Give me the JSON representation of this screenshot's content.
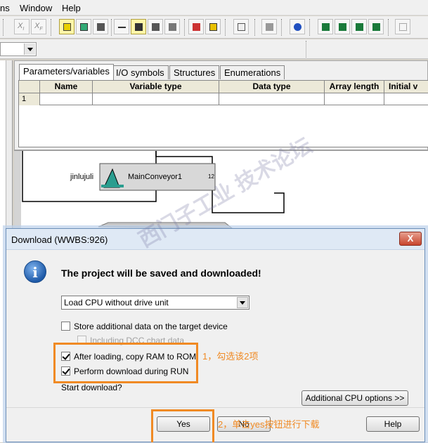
{
  "menu": [
    "ns",
    "Window",
    "Help"
  ],
  "toolbar": {
    "icons": [
      "xi-icon",
      "xf-icon",
      "block-icon",
      "download-icon",
      "compare-icon",
      "connect-icon",
      "insert-block-icon",
      "move-icon",
      "chart-icon",
      "parameters-icon",
      "upload-icon",
      "list-icon",
      "lock-icon",
      "test-mode-icon",
      "monitor-icon",
      "trend1-icon",
      "trend2-icon",
      "trend3-icon",
      "trend4-icon",
      "settings-grid-icon"
    ]
  },
  "interface_editor": {
    "tabs": [
      "Parameters/variables",
      "I/O symbols",
      "Structures",
      "Enumerations"
    ],
    "columns": [
      "Name",
      "Variable type",
      "Data type",
      "Array length",
      "Initial v"
    ],
    "rows": [
      {
        "num": "1"
      }
    ]
  },
  "chart": {
    "block_label": "jinlujuli",
    "block_name": "MainConveyor1",
    "block_number": "12"
  },
  "watermark": "西门子工业 技术论坛",
  "dialog": {
    "title": "Download (WWBS:926)",
    "close_label": "X",
    "message": "The project will be saved and downloaded!",
    "select_value": "Load CPU without drive unit",
    "options": [
      {
        "label": "Store additional data on the target device",
        "checked": false,
        "disabled": false
      },
      {
        "label": "Including DCC chart data",
        "checked": false,
        "disabled": true
      },
      {
        "label": "After loading, copy RAM to ROM",
        "checked": true,
        "disabled": false
      },
      {
        "label": "Perform download during RUN",
        "checked": true,
        "disabled": false
      }
    ],
    "start_prompt": "Start download?",
    "additional_button": "Additional CPU options >>",
    "yes_button": "Yes",
    "no_button": "No",
    "help_button": "Help"
  },
  "annotations": {
    "step1": "1，勾选该2项",
    "step2": "2，单击yes按钮进行下载"
  },
  "colors": {
    "annotation": "#f08a24",
    "block": "#2a9d8f"
  }
}
